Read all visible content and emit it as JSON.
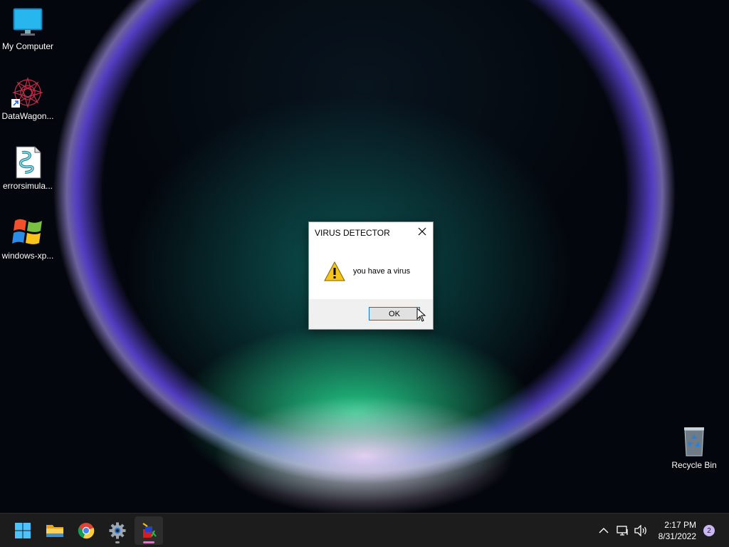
{
  "desktop": {
    "icons": [
      {
        "label": "My Computer",
        "icon": "monitor-icon"
      },
      {
        "label": "DataWagon...",
        "icon": "mandala-shortcut-icon"
      },
      {
        "label": "errorsimula...",
        "icon": "script-file-icon"
      },
      {
        "label": "windows-xp...",
        "icon": "windows-xp-logo-icon"
      }
    ],
    "recycle_bin": {
      "label": "Recycle Bin",
      "icon": "recycle-bin-icon"
    }
  },
  "dialog": {
    "title": "VIRUS DETECTOR",
    "message": "you have a virus",
    "ok_label": "OK",
    "icon": "warning-icon"
  },
  "taskbar": {
    "apps": [
      {
        "name": "start",
        "icon": "windows-start-icon"
      },
      {
        "name": "file-explorer",
        "icon": "folder-icon"
      },
      {
        "name": "chrome",
        "icon": "chrome-icon"
      },
      {
        "name": "settings",
        "icon": "gear-icon"
      },
      {
        "name": "error-simulator",
        "icon": "app-icon"
      }
    ],
    "tray": {
      "time": "2:17 PM",
      "date": "8/31/2022",
      "notification_count": "2"
    }
  },
  "colors": {
    "accent": "#0078d7",
    "taskbar": "#1c1c1c",
    "notification": "#c9b6f3"
  }
}
